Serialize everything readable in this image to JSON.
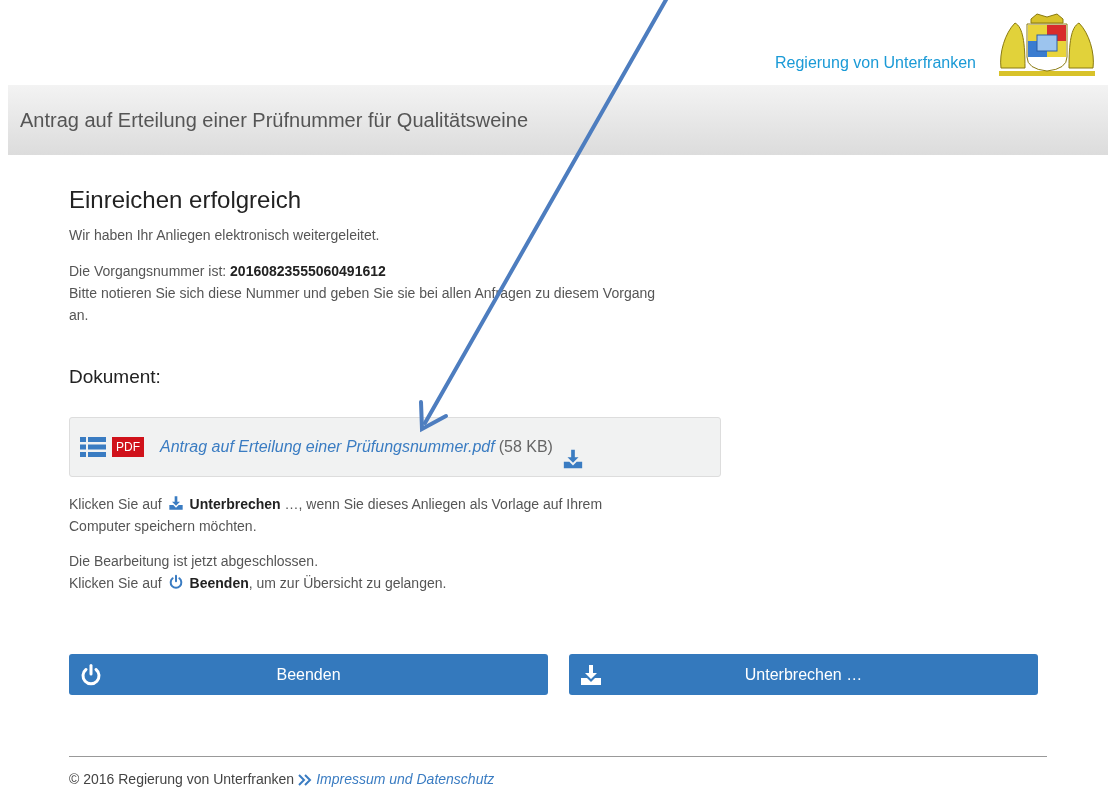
{
  "header": {
    "agency": "Regierung von Unterfranken"
  },
  "title_bar": {
    "title": "Antrag auf Erteilung einer Prüfnummer für Qualitätsweine"
  },
  "content": {
    "heading": "Einreichen erfolgreich",
    "message": "Wir haben Ihr Anliegen elektronisch weitergeleitet.",
    "reference_lines": [
      "Die Vorgangsnummer ist: **20160823555060491612**",
      "Bitte notieren Sie sich diese Nummer und geben Sie sie bei allen Anfragen zu diesem Vorgang an."
    ],
    "documents_heading": "Dokument:",
    "document": {
      "badge": "PDF",
      "filename": "Antrag auf Erteilung einer Prüfungsnummer.pdf",
      "size": "(58 KB)"
    },
    "hints": [
      {
        "kind": "download",
        "before": "Klicken Sie auf",
        "after": "**Unterbrechen** …, wenn Sie dieses Anliegen als Vorlage auf Ihrem",
        "after_continued": "Computer speichern möchten."
      },
      {
        "kind": "power",
        "lead": "Die Bearbeitung ist jetzt abgeschlossen.",
        "before": "Klicken Sie auf",
        "after": "**Beenden**, um zur Übersicht zu gelangen."
      }
    ]
  },
  "buttons": [
    {
      "kind": "power",
      "label": "Beenden"
    },
    {
      "kind": "download",
      "label": "Unterbrechen …"
    }
  ],
  "footer": {
    "copyright": "© 2016 Regierung von Unterfranken",
    "link": "Impressum und Datenschutz"
  }
}
